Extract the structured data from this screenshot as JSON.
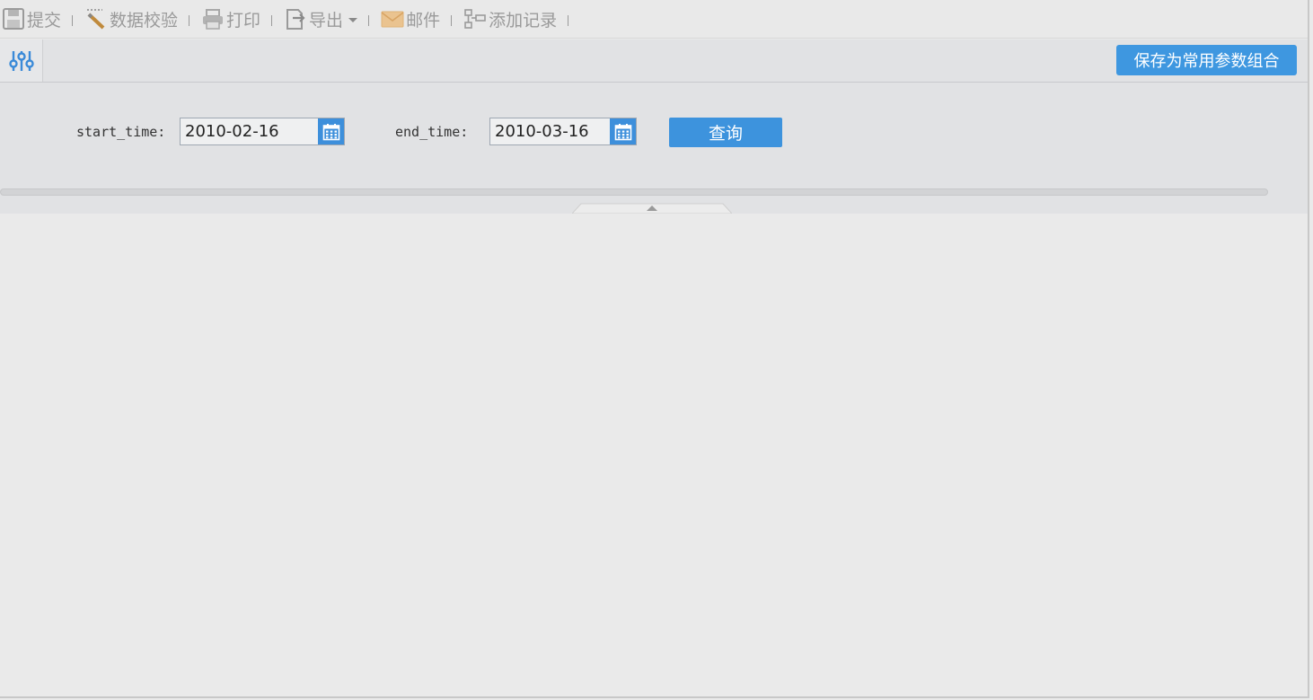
{
  "toolbar": {
    "items": [
      {
        "label": "提交",
        "icon": "save-icon"
      },
      {
        "label": "数据校验",
        "icon": "pencil-icon"
      },
      {
        "label": "打印",
        "icon": "printer-icon"
      },
      {
        "label": "导出",
        "icon": "export-icon"
      },
      {
        "label": "邮件",
        "icon": "mail-icon"
      },
      {
        "label": "添加记录",
        "icon": "add-record-icon"
      }
    ]
  },
  "param_panel": {
    "toggle_icon": "sliders-icon",
    "save_combo_label": "保存为常用参数组合",
    "start_time_label": "start_time:",
    "start_time_value": "2010-02-16",
    "end_time_label": "end_time:",
    "end_time_value": "2010-03-16",
    "query_label": "查询"
  },
  "colors": {
    "accent": "#3e97e0",
    "toolbar_text": "#9a9a9a",
    "panel_bg": "#e1e2e4"
  }
}
